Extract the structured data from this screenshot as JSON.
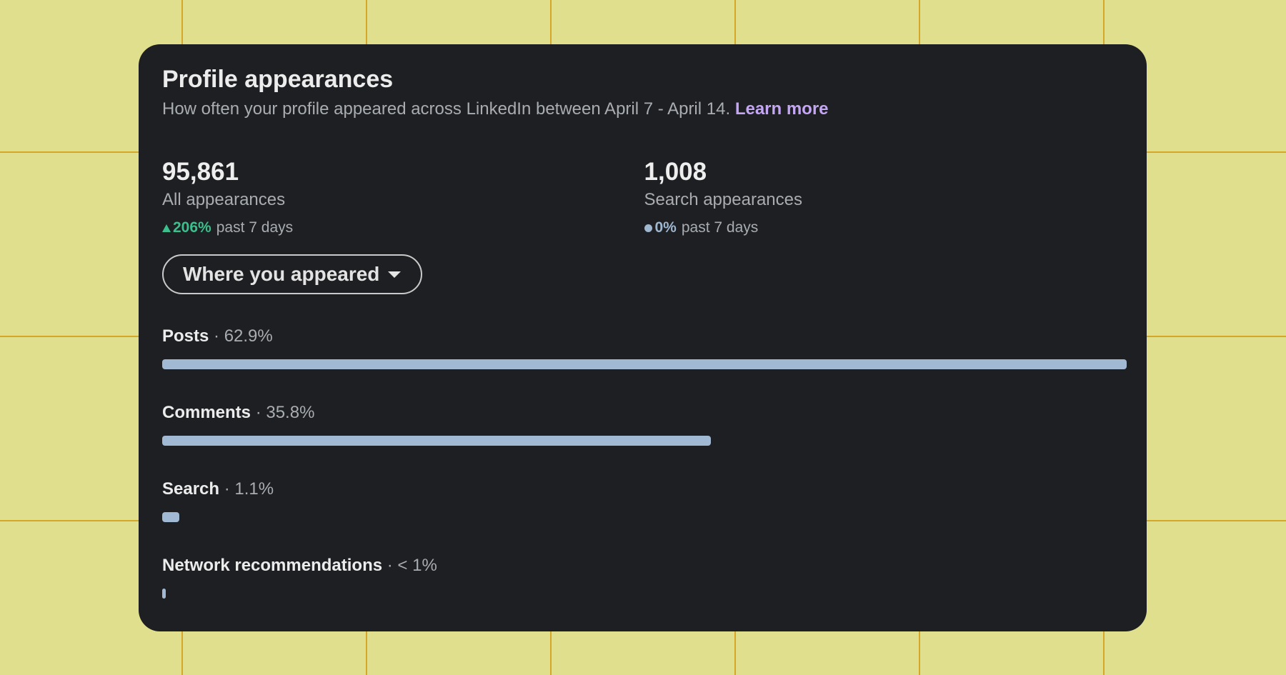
{
  "card": {
    "title": "Profile appearances",
    "subtitle_text": "How often your profile appeared across LinkedIn between April 7 - April 14.",
    "learn_more": "Learn more"
  },
  "stats": [
    {
      "value": "95,861",
      "label": "All appearances",
      "change": "206%",
      "period": "past 7 days",
      "trend_icon": "up-triangle-icon"
    },
    {
      "value": "1,008",
      "label": "Search appearances",
      "change": "0%",
      "period": "past 7 days",
      "trend_icon": "neutral-dot-icon"
    }
  ],
  "dropdown": {
    "label": "Where you appeared",
    "icon": "caret-down-icon"
  },
  "breakdown": [
    {
      "name": "Posts",
      "pct_text": " · 62.9%",
      "share": 62.9
    },
    {
      "name": "Comments",
      "pct_text": " · 35.8%",
      "share": 35.8
    },
    {
      "name": "Search",
      "pct_text": " · 1.1%",
      "share": 1.1
    },
    {
      "name": "Network recommendations",
      "pct_text": " · < 1%",
      "share": 0.2
    }
  ],
  "colors": {
    "background": "#e0df8e",
    "grid_lines": "#d6a629",
    "card": "#1d1f22",
    "bar": "#a1b9d2",
    "positive": "#3bbf8c",
    "link": "#c4a6f5"
  }
}
